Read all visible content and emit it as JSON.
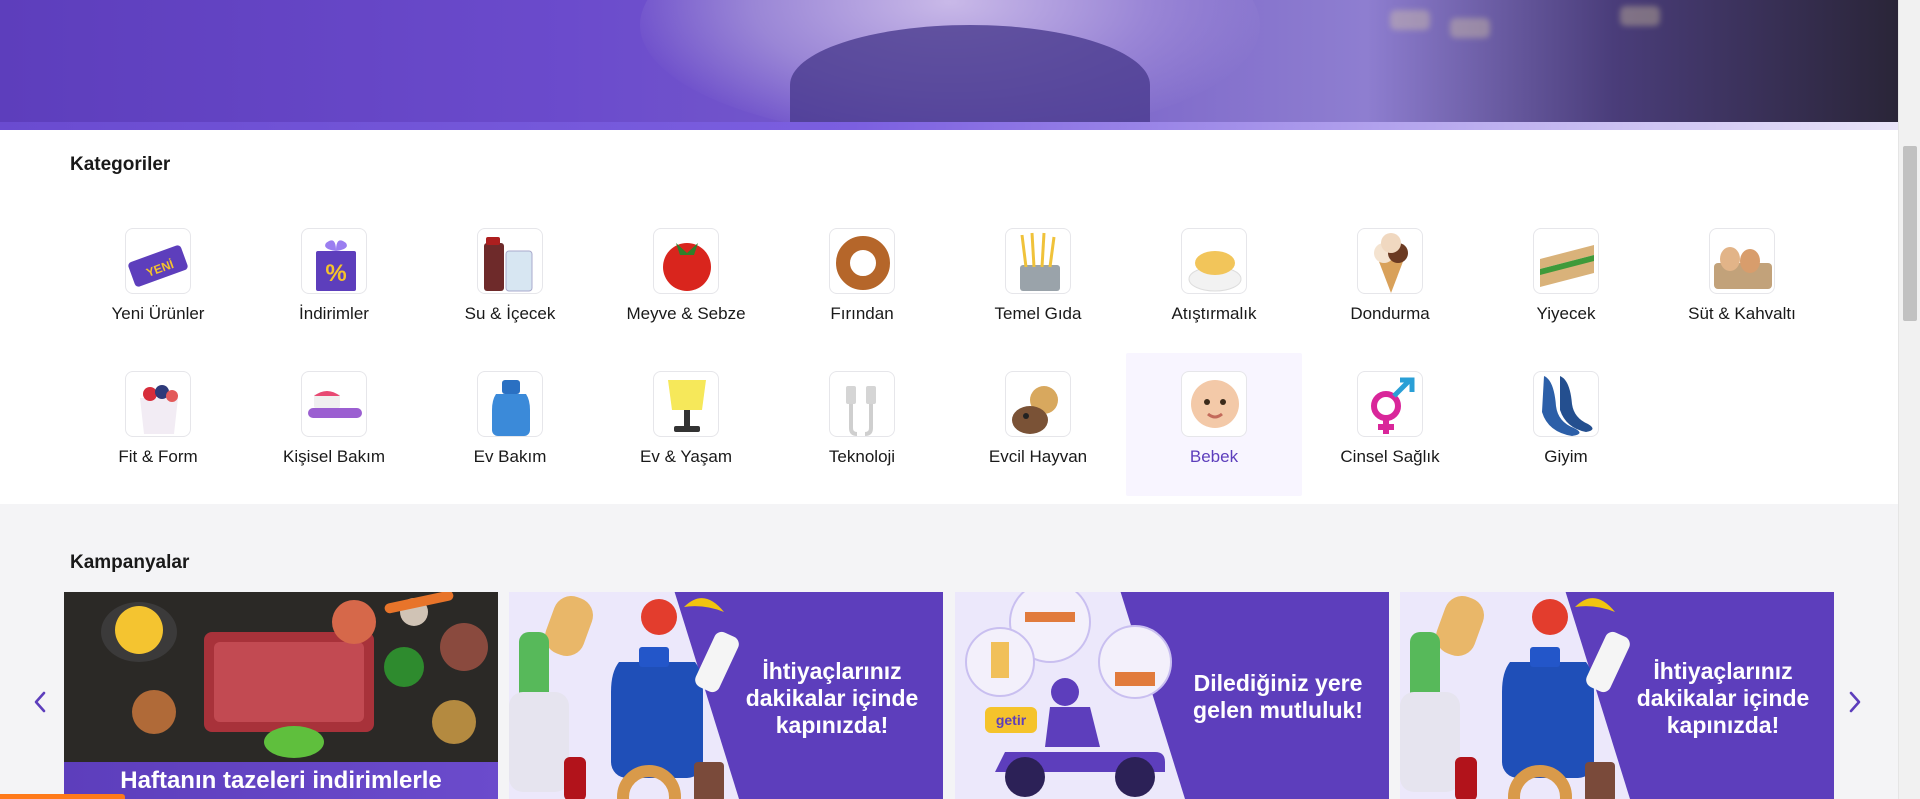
{
  "categories": {
    "title": "Kategoriler",
    "items": [
      {
        "label": "Yeni Ürünler",
        "icon": "new-tag-icon"
      },
      {
        "label": "İndirimler",
        "icon": "discount-gift-icon"
      },
      {
        "label": "Su & İçecek",
        "icon": "drinks-icon"
      },
      {
        "label": "Meyve & Sebze",
        "icon": "tomato-icon"
      },
      {
        "label": "Fırından",
        "icon": "simit-icon"
      },
      {
        "label": "Temel Gıda",
        "icon": "pasta-icon"
      },
      {
        "label": "Atıştırmalık",
        "icon": "chips-icon"
      },
      {
        "label": "Dondurma",
        "icon": "ice-cream-icon"
      },
      {
        "label": "Yiyecek",
        "icon": "sandwich-icon"
      },
      {
        "label": "Süt & Kahvaltı",
        "icon": "eggs-icon"
      },
      {
        "label": "Fit & Form",
        "icon": "yogurt-icon"
      },
      {
        "label": "Kişisel Bakım",
        "icon": "toothbrush-icon"
      },
      {
        "label": "Ev Bakım",
        "icon": "detergent-icon"
      },
      {
        "label": "Ev & Yaşam",
        "icon": "lamp-icon"
      },
      {
        "label": "Teknoloji",
        "icon": "cable-icon"
      },
      {
        "label": "Evcil Hayvan",
        "icon": "pets-icon"
      },
      {
        "label": "Bebek",
        "icon": "baby-icon",
        "active": true
      },
      {
        "label": "Cinsel Sağlık",
        "icon": "gender-icon"
      },
      {
        "label": "Giyim",
        "icon": "socks-icon"
      }
    ]
  },
  "campaigns": {
    "title": "Kampanyalar",
    "banners": [
      {
        "text": "Haftanın tazeleri indirimlerle sofranızda!"
      },
      {
        "text": "İhtiyaçlarınız dakikalar içinde kapınızda!"
      },
      {
        "text": "Dilediğiniz yere gelen mutluluk!",
        "logo": "getir"
      },
      {
        "text": "İhtiyaçlarınız dakikalar içinde kapınızda!"
      }
    ],
    "prev_icon": "chevron-left-icon",
    "next_icon": "chevron-right-icon"
  },
  "colors": {
    "brand": "#5d3ebc",
    "active_bg": "#f8f5ff",
    "accent_orange": "#ff7a1a"
  }
}
